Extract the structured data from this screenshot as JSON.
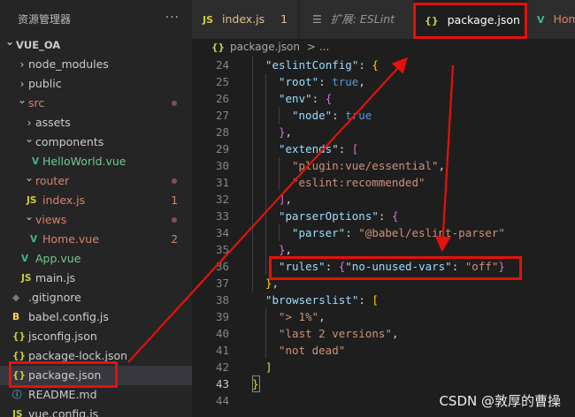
{
  "sidebar": {
    "title": "资源管理器",
    "more": "···",
    "tree": [
      {
        "label": "VUE_OA",
        "type": "root",
        "expanded": true
      },
      {
        "label": "node_modules",
        "type": "folder"
      },
      {
        "label": "public",
        "type": "folder"
      },
      {
        "label": "src",
        "type": "folder",
        "expanded": true,
        "status": "dot"
      },
      {
        "label": "assets",
        "type": "folder"
      },
      {
        "label": "components",
        "type": "folder",
        "expanded": true
      },
      {
        "label": "HelloWorld.vue",
        "type": "vue"
      },
      {
        "label": "router",
        "type": "folder",
        "expanded": true,
        "status": "dot"
      },
      {
        "label": "index.js",
        "type": "js",
        "badge": "1"
      },
      {
        "label": "views",
        "type": "folder",
        "expanded": true,
        "status": "dot"
      },
      {
        "label": "Home.vue",
        "type": "vue",
        "badge": "2"
      },
      {
        "label": "App.vue",
        "type": "vue"
      },
      {
        "label": "main.js",
        "type": "js"
      },
      {
        "label": ".gitignore",
        "type": "git"
      },
      {
        "label": "babel.config.js",
        "type": "babel"
      },
      {
        "label": "jsconfig.json",
        "type": "json"
      },
      {
        "label": "package-lock.json",
        "type": "json"
      },
      {
        "label": "package.json",
        "type": "json",
        "selected": true
      },
      {
        "label": "README.md",
        "type": "info"
      },
      {
        "label": "vue.config.js",
        "type": "js"
      }
    ]
  },
  "tabs": [
    {
      "icon": "JS",
      "label": "index.js",
      "badge": "1"
    },
    {
      "icon": "☰",
      "label": "扩展: ESLint"
    },
    {
      "icon": "{}",
      "label": "package.json",
      "close": "×",
      "active": true
    },
    {
      "icon": "V",
      "label": "Hom"
    }
  ],
  "breadcrumb": {
    "icon": "{}",
    "file": "package.json",
    "sep": ">",
    "rest": "..."
  },
  "code": {
    "lines": [
      {
        "n": "24",
        "tokens": [
          [
            "k",
            "\"eslintConfig\""
          ],
          [
            "p",
            ": "
          ],
          [
            "br1",
            "{"
          ]
        ]
      },
      {
        "n": "25",
        "tokens": [
          [
            "k",
            "\"root\""
          ],
          [
            "p",
            ": "
          ],
          [
            "b",
            "true"
          ],
          [
            "p",
            ","
          ]
        ]
      },
      {
        "n": "26",
        "tokens": [
          [
            "k",
            "\"env\""
          ],
          [
            "p",
            ": "
          ],
          [
            "br2",
            "{"
          ]
        ]
      },
      {
        "n": "27",
        "tokens": [
          [
            "k",
            "\"node\""
          ],
          [
            "p",
            ": "
          ],
          [
            "b",
            "true"
          ]
        ]
      },
      {
        "n": "28",
        "tokens": [
          [
            "br2",
            "}"
          ],
          [
            "p",
            ","
          ]
        ]
      },
      {
        "n": "29",
        "tokens": [
          [
            "k",
            "\"extends\""
          ],
          [
            "p",
            ": "
          ],
          [
            "br2",
            "["
          ]
        ]
      },
      {
        "n": "30",
        "tokens": [
          [
            "s",
            "\"plugin:vue/essential\""
          ],
          [
            "p",
            ","
          ]
        ]
      },
      {
        "n": "31",
        "tokens": [
          [
            "s",
            "\"eslint:recommended\""
          ]
        ]
      },
      {
        "n": "32",
        "tokens": [
          [
            "br2",
            "]"
          ],
          [
            "p",
            ","
          ]
        ]
      },
      {
        "n": "33",
        "tokens": [
          [
            "k",
            "\"parserOptions\""
          ],
          [
            "p",
            ": "
          ],
          [
            "br2",
            "{"
          ]
        ]
      },
      {
        "n": "34",
        "tokens": [
          [
            "k",
            "\"parser\""
          ],
          [
            "p",
            ": "
          ],
          [
            "s",
            "\"@babel/eslint-parser\""
          ]
        ]
      },
      {
        "n": "35",
        "tokens": [
          [
            "br2",
            "}"
          ],
          [
            "p",
            ","
          ]
        ]
      },
      {
        "n": "36",
        "tokens": [
          [
            "k",
            "\"rules\""
          ],
          [
            "p",
            ": "
          ],
          [
            "br2",
            "{"
          ],
          [
            "k",
            "\"no-unused-vars\""
          ],
          [
            "p",
            ": "
          ],
          [
            "s",
            "\"off\""
          ],
          [
            "br2",
            "}"
          ]
        ]
      },
      {
        "n": "37",
        "tokens": [
          [
            "br1",
            "}"
          ],
          [
            "p",
            ","
          ]
        ]
      },
      {
        "n": "38",
        "tokens": [
          [
            "k",
            "\"browserslist\""
          ],
          [
            "p",
            ": "
          ],
          [
            "br1",
            "["
          ]
        ]
      },
      {
        "n": "39",
        "tokens": [
          [
            "s",
            "\"> 1%\""
          ],
          [
            "p",
            ","
          ]
        ]
      },
      {
        "n": "40",
        "tokens": [
          [
            "s",
            "\"last 2 versions\""
          ],
          [
            "p",
            ","
          ]
        ]
      },
      {
        "n": "41",
        "tokens": [
          [
            "s",
            "\"not dead\""
          ]
        ]
      },
      {
        "n": "42",
        "tokens": [
          [
            "br1",
            "]"
          ]
        ]
      },
      {
        "n": "43",
        "tokens": [
          [
            "br1",
            "}"
          ]
        ]
      },
      {
        "n": "44",
        "tokens": []
      }
    ]
  },
  "watermark": "CSDN @敦厚的曹操",
  "colors": {
    "annotation": "#e3120b",
    "background": "#1e1e1e",
    "sidebar": "#252526"
  }
}
